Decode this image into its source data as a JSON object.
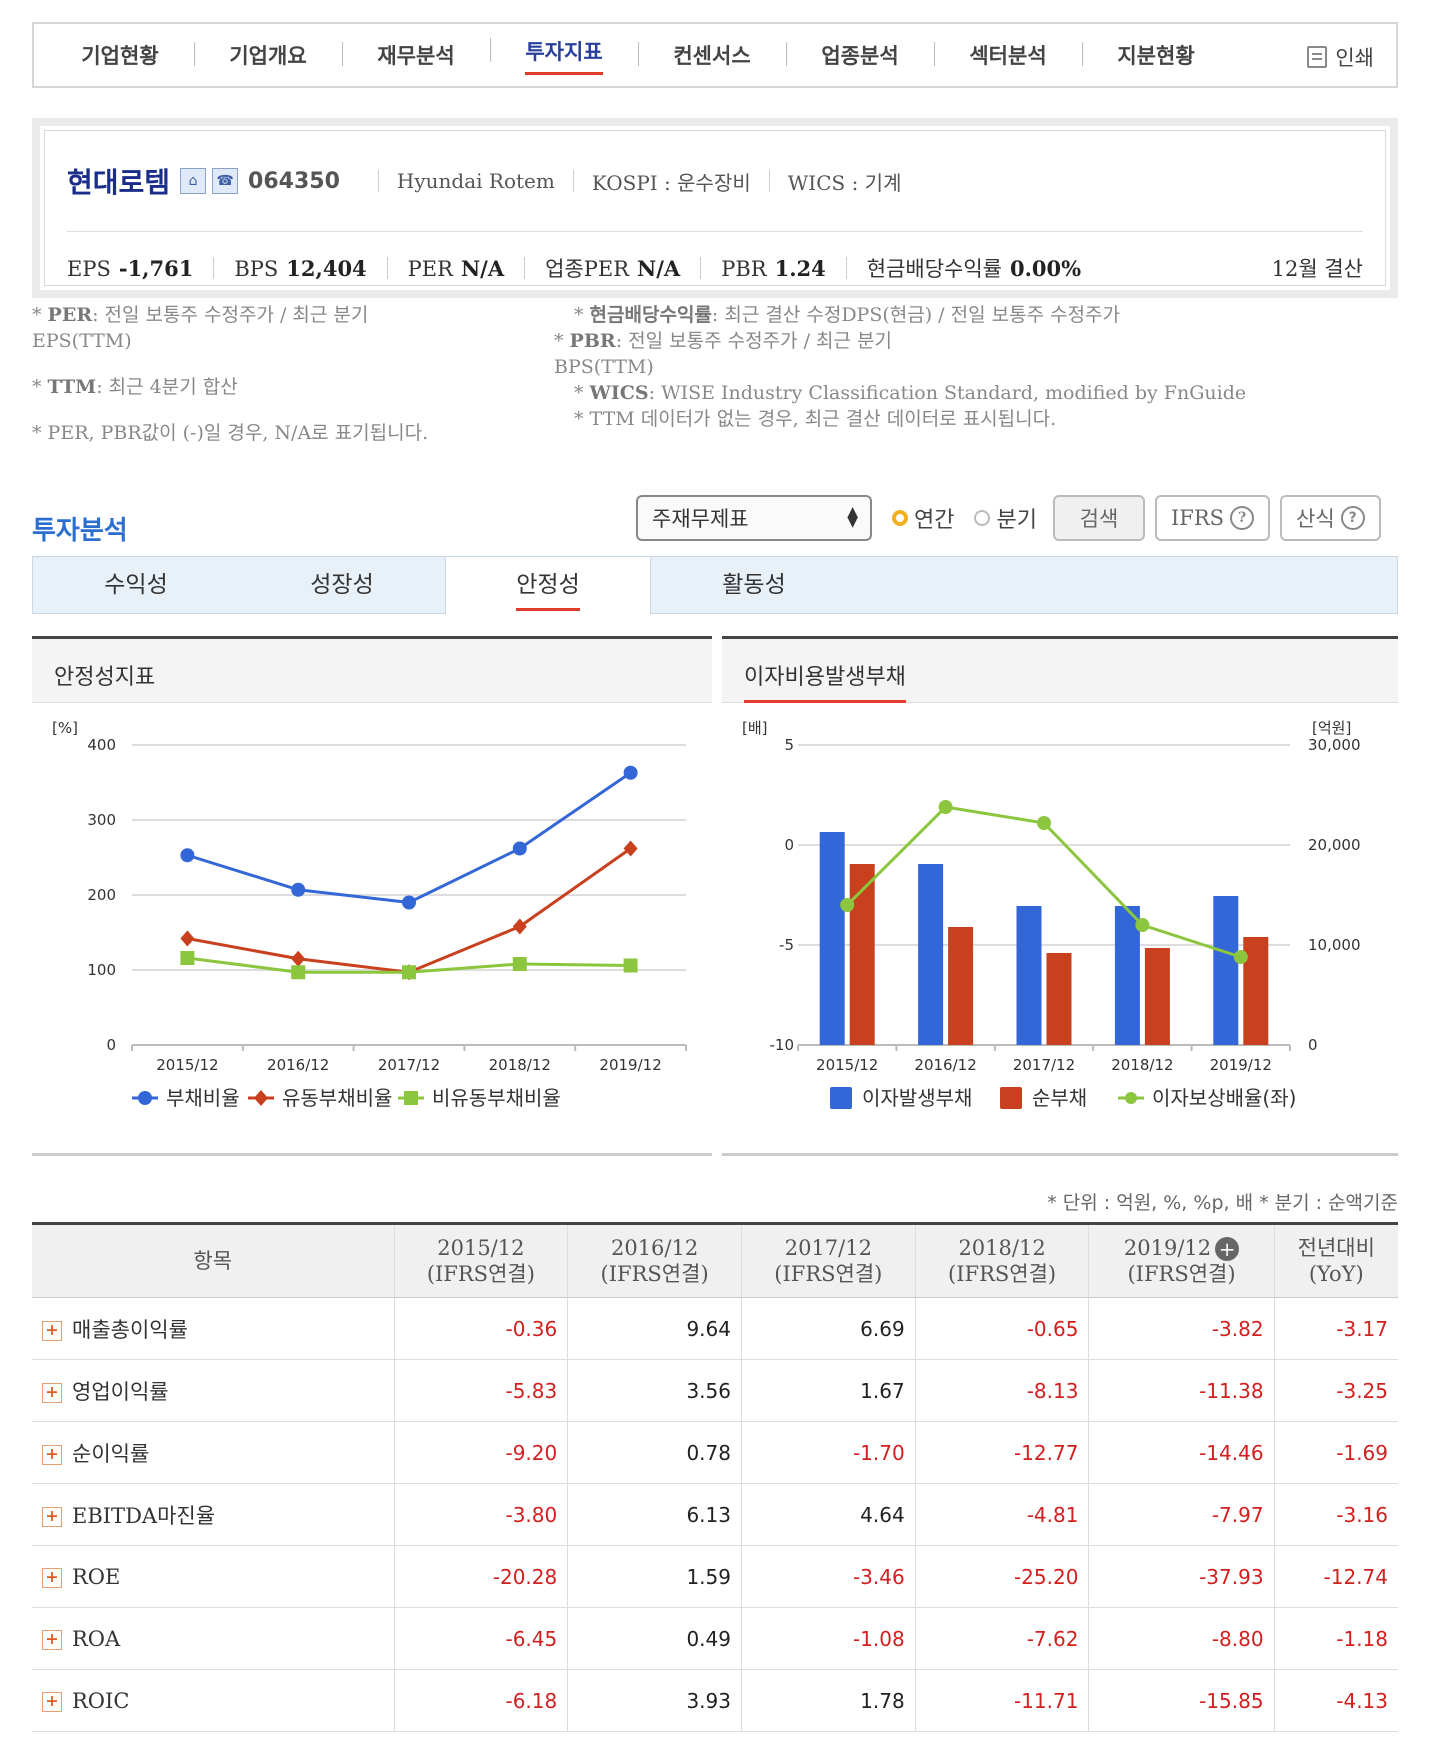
{
  "nav": {
    "tabs": [
      "기업현황",
      "기업개요",
      "재무분석",
      "투자지표",
      "컨센서스",
      "업종분석",
      "섹터분석",
      "지분현황"
    ],
    "active_index": 3,
    "print_label": "인쇄"
  },
  "company": {
    "name": "현대로템",
    "code": "064350",
    "english_name": "Hyundai Rotem",
    "market": "KOSPI : 운수장비",
    "wics": "WICS : 기계",
    "eps_label": "EPS",
    "eps_value": "-1,761",
    "bps_label": "BPS",
    "bps_value": "12,404",
    "per_label": "PER",
    "per_value": "N/A",
    "sector_per_label": "업종PER",
    "sector_per_value": "N/A",
    "pbr_label": "PBR",
    "pbr_value": "1.24",
    "dividend_label": "현금배당수익률",
    "dividend_value": "0.00%",
    "settlement": "12월 결산"
  },
  "notes": {
    "per_key": "PER",
    "per_text": ": 전일 보통주 수정주가 / 최근 분기 EPS(TTM)",
    "ttm_key": "TTM",
    "ttm_text": ": 최근 4분기 합산",
    "na_text": "* PER, PBR값이 (-)일 경우, N/A로 표기됩니다.",
    "div_key": "현금배당수익률",
    "div_text": ": 최근 결산 수정DPS(현금) / 전일 보통주 수정주가",
    "pbr_key": "PBR",
    "pbr_text": ": 전일 보통주 수정주가 / 최근 분기 BPS(TTM)",
    "wics_key": "WICS",
    "wics_text": ": WISE Industry Classification Standard, modified by FnGuide",
    "ttm_missing_text": "* TTM 데이터가 없는 경우, 최근 결산 데이터로 표시됩니다."
  },
  "analysis": {
    "title": "투자분석",
    "select_value": "주재무제표",
    "radio_annual": "연간",
    "radio_quarter": "분기",
    "search_label": "검색",
    "ifrs_label": "IFRS",
    "formula_label": "산식",
    "help_glyph": "?",
    "subtabs": [
      "수익성",
      "성장성",
      "안정성",
      "활동성"
    ],
    "active_subtab": 2
  },
  "chart1_title": "안정성지표",
  "chart2_title": "이자비용발생부채",
  "chart_data": [
    {
      "type": "line",
      "title": "안정성지표",
      "ylabel": "[%]",
      "ylim": [
        0,
        400
      ],
      "yticks": [
        0,
        100,
        200,
        300,
        400
      ],
      "categories": [
        "2015/12",
        "2016/12",
        "2017/12",
        "2018/12",
        "2019/12"
      ],
      "series": [
        {
          "name": "부채비율",
          "color": "#3366d6",
          "marker": "circle",
          "values": [
            253,
            207,
            190,
            262,
            363
          ]
        },
        {
          "name": "유동부채비율",
          "color": "#c8401e",
          "marker": "diamond",
          "values": [
            142,
            115,
            97,
            158,
            262
          ]
        },
        {
          "name": "비유동부채비율",
          "color": "#8cc63f",
          "marker": "square",
          "values": [
            116,
            97,
            97,
            108,
            106
          ]
        }
      ],
      "grid": true,
      "legend": "bottom"
    },
    {
      "type": "bar",
      "title": "이자비용발생부채",
      "ylabel_left": "[배]",
      "ylabel_right": "[억원]",
      "ylim_left": [
        -10,
        5
      ],
      "yticks_left": [
        "5",
        "0",
        "-5",
        "-10"
      ],
      "ylim_right": [
        0,
        30000
      ],
      "yticks_right": [
        "30,000",
        "20,000",
        "10,000",
        "0"
      ],
      "categories": [
        "2015/12",
        "2016/12",
        "2017/12",
        "2018/12",
        "2019/12"
      ],
      "series": [
        {
          "name": "이자발생부채",
          "color": "#3366d6",
          "axis": "right",
          "kind": "bar",
          "values": [
            21300,
            18100,
            13900,
            13900,
            14900
          ]
        },
        {
          "name": "순부채",
          "color": "#c8401e",
          "axis": "right",
          "kind": "bar",
          "values": [
            18100,
            11800,
            9200,
            9700,
            10800
          ]
        },
        {
          "name": "이자보상배율(좌)",
          "color": "#8cc63f",
          "axis": "left",
          "kind": "line",
          "values": [
            -3.0,
            1.9,
            1.1,
            -4.0,
            -5.6
          ]
        }
      ],
      "grid": true,
      "legend": "bottom"
    }
  ],
  "unit_note": "* 단위 : 억원, %, %p, 배     * 분기 : 순액기준",
  "table": {
    "headers": [
      {
        "l1": "항목",
        "l2": ""
      },
      {
        "l1": "2015/12",
        "l2": "(IFRS연결)"
      },
      {
        "l1": "2016/12",
        "l2": "(IFRS연결)"
      },
      {
        "l1": "2017/12",
        "l2": "(IFRS연결)"
      },
      {
        "l1": "2018/12",
        "l2": "(IFRS연결)"
      },
      {
        "l1": "2019/12",
        "l2": "(IFRS연결)"
      },
      {
        "l1": "전년대비",
        "l2": "(YoY)"
      }
    ],
    "rows": [
      {
        "label": "매출총이익률",
        "values": [
          "-0.36",
          "9.64",
          "6.69",
          "-0.65",
          "-3.82",
          "-3.17"
        ]
      },
      {
        "label": "영업이익률",
        "values": [
          "-5.83",
          "3.56",
          "1.67",
          "-8.13",
          "-11.38",
          "-3.25"
        ]
      },
      {
        "label": "순이익률",
        "values": [
          "-9.20",
          "0.78",
          "-1.70",
          "-12.77",
          "-14.46",
          "-1.69"
        ]
      },
      {
        "label": "EBITDA마진율",
        "values": [
          "-3.80",
          "6.13",
          "4.64",
          "-4.81",
          "-7.97",
          "-3.16"
        ]
      },
      {
        "label": "ROE",
        "values": [
          "-20.28",
          "1.59",
          "-3.46",
          "-25.20",
          "-37.93",
          "-12.74"
        ]
      },
      {
        "label": "ROA",
        "values": [
          "-6.45",
          "0.49",
          "-1.08",
          "-7.62",
          "-8.80",
          "-1.18"
        ]
      },
      {
        "label": "ROIC",
        "values": [
          "-6.18",
          "3.93",
          "1.78",
          "-11.71",
          "-15.85",
          "-4.13"
        ]
      }
    ]
  }
}
